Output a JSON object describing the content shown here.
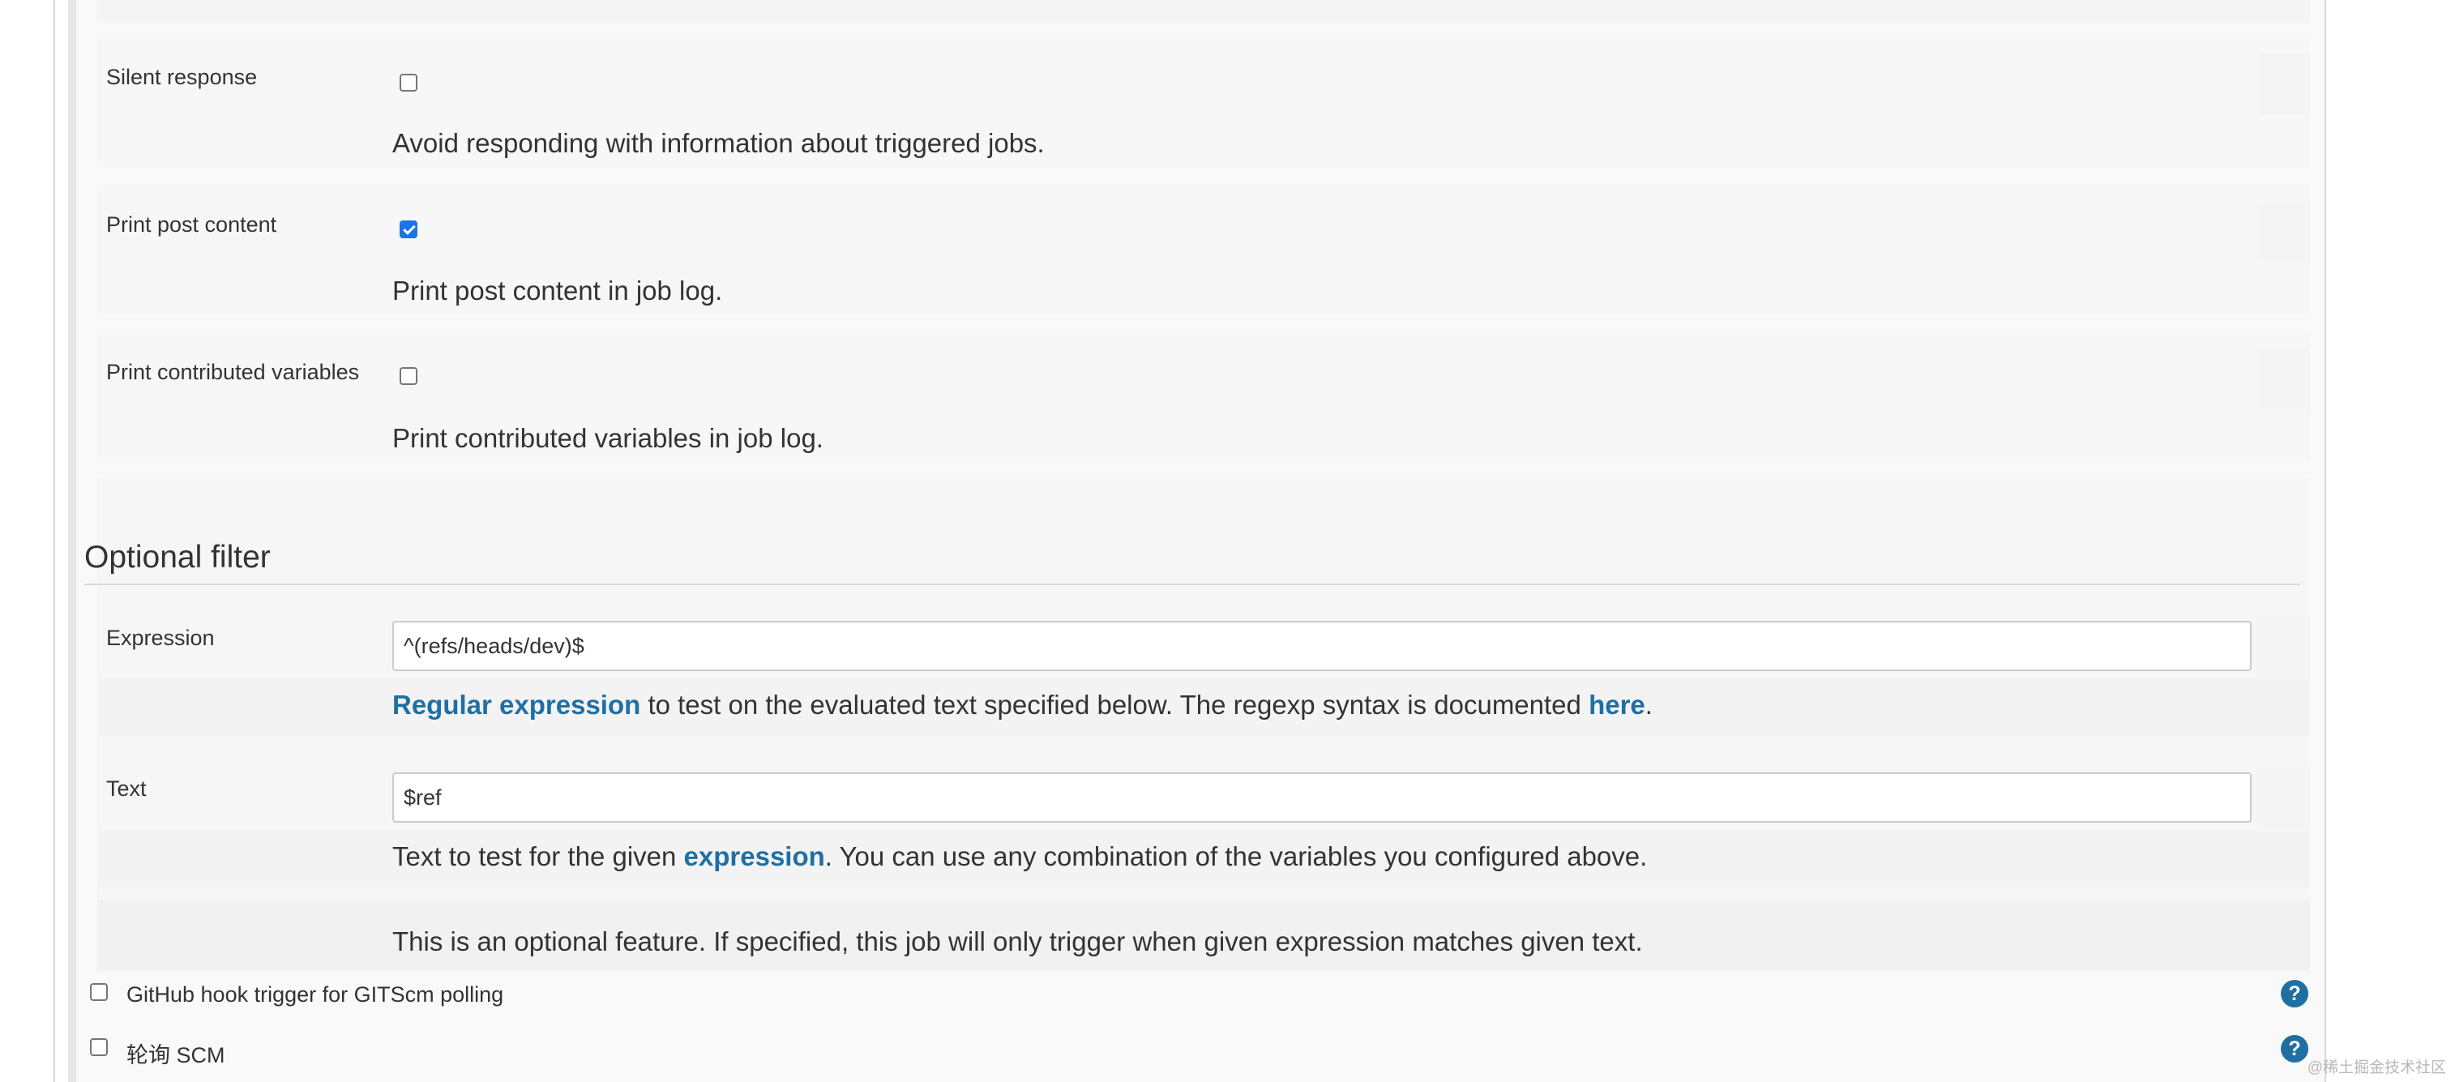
{
  "options": [
    {
      "label": "Silent response",
      "checked": false,
      "description": "Avoid responding with information about triggered jobs."
    },
    {
      "label": "Print post content",
      "checked": true,
      "description": "Print post content in job log."
    },
    {
      "label": "Print contributed variables",
      "checked": false,
      "description": "Print contributed variables in job log."
    }
  ],
  "optional_filter": {
    "title": "Optional filter",
    "expression": {
      "label": "Expression",
      "value": "^(refs/heads/dev)$",
      "help_link": "Regular expression",
      "help_middle": " to test on the evaluated text specified below. The regexp syntax is documented ",
      "help_link2": "here",
      "help_end": "."
    },
    "text": {
      "label": "Text",
      "value": "$ref",
      "help_start": "Text to test for the given ",
      "help_link": "expression",
      "help_end": ". You can use any combination of the variables you configured above."
    },
    "note": "This is an optional feature. If specified, this job will only trigger when given expression matches given text."
  },
  "triggers": [
    {
      "label": "GitHub hook trigger for GITScm polling",
      "checked": false,
      "help_icon": "?"
    },
    {
      "label": "轮询 SCM",
      "checked": false,
      "help_icon": "?"
    }
  ],
  "watermark": "@稀土掘金技术社区",
  "colors": {
    "link": "#1f6fa3",
    "checkbox_checked": "#1a73e8",
    "panel": "#f9f9f9"
  }
}
